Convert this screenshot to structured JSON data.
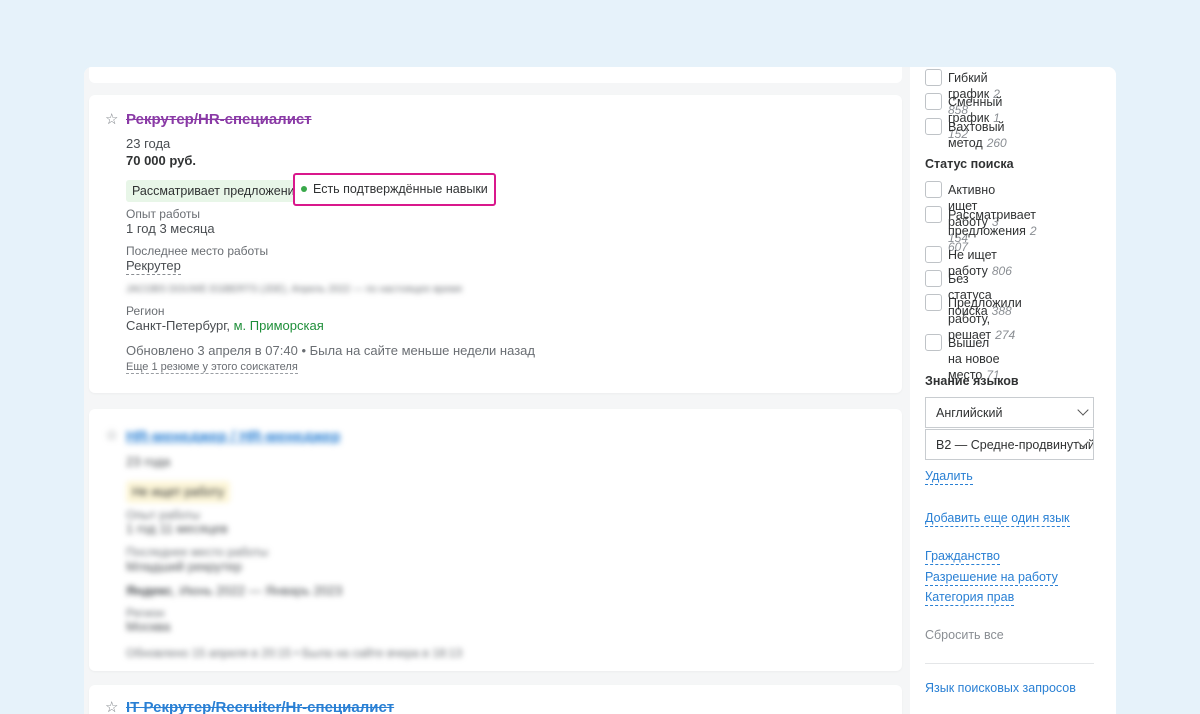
{
  "results": [
    {
      "title": "Рекрутер/HR-специалист",
      "age": "23 года",
      "salary": "70 000 руб.",
      "status_badge": "Рассматривает предложения",
      "skills_badge": "Есть подтверждённые навыки",
      "experience_label": "Опыт работы",
      "experience_value": "1 год 3 месяца",
      "last_job_label": "Последнее место работы",
      "last_job_value": "Рекрутер",
      "last_company_line": "JACOBS DOUWE EGBERTS (JDE), Апрель 2022 — по настоящее время",
      "region_label": "Регион",
      "region_city": "Санкт-Петербург,",
      "region_metro": "м. Приморская",
      "updated": "Обновлено 3 апреля в 07:40 • Была на сайте меньше недели назад",
      "more_resumes": "Еще 1 резюме у этого соискателя"
    },
    {
      "title": "HR-менеджер / HR-менеджер",
      "age": "23 года",
      "status_badge": "Не ищет работу",
      "experience_label": "Опыт работы",
      "experience_value": "1 год 11 месяцев",
      "last_job_label": "Последнее место работы",
      "last_job_value": "Младший рекрутер",
      "last_company": "Яндекс",
      "last_company_period": ", Июнь 2022 — Январь 2023",
      "region_label": "Регион",
      "region_city": "Москва",
      "updated": "Обновлено 15 апреля в 20:15 • Была на сайте вчера в 18:13"
    },
    {
      "title": "IT Рекрутер/Recruiter/Hr-специалист"
    }
  ],
  "sidebar": {
    "schedule": [
      {
        "label": "Гибкий график",
        "count": "2 858"
      },
      {
        "label": "Сменный график",
        "count": "1 152"
      },
      {
        "label": "Вахтовый метод",
        "count": "260"
      }
    ],
    "search_status_title": "Статус поиска",
    "search_status": [
      {
        "label": "Активно ищет работу",
        "count": "3 154"
      },
      {
        "line1": "Рассматривает",
        "line2": "предложения",
        "count": "2 607"
      },
      {
        "label": "Не ищет работу",
        "count": "806"
      },
      {
        "label": "Без статуса поиска",
        "count": "388"
      },
      {
        "line1": "Предложили работу,",
        "line2": "решает",
        "count": "274"
      },
      {
        "label": "Вышел на новое место",
        "count": "71"
      }
    ],
    "languages_title": "Знание языков",
    "language_select": "Английский",
    "level_select": "B2 — Средне-продвинутый",
    "delete_link": "Удалить",
    "add_language_link": "Добавить еще один язык",
    "citizenship_link": "Гражданство",
    "work_permit_link": "Разрешение на работу",
    "license_link": "Категория прав",
    "reset_all": "Сбросить все",
    "query_language_link": "Язык поисковых запросов"
  }
}
